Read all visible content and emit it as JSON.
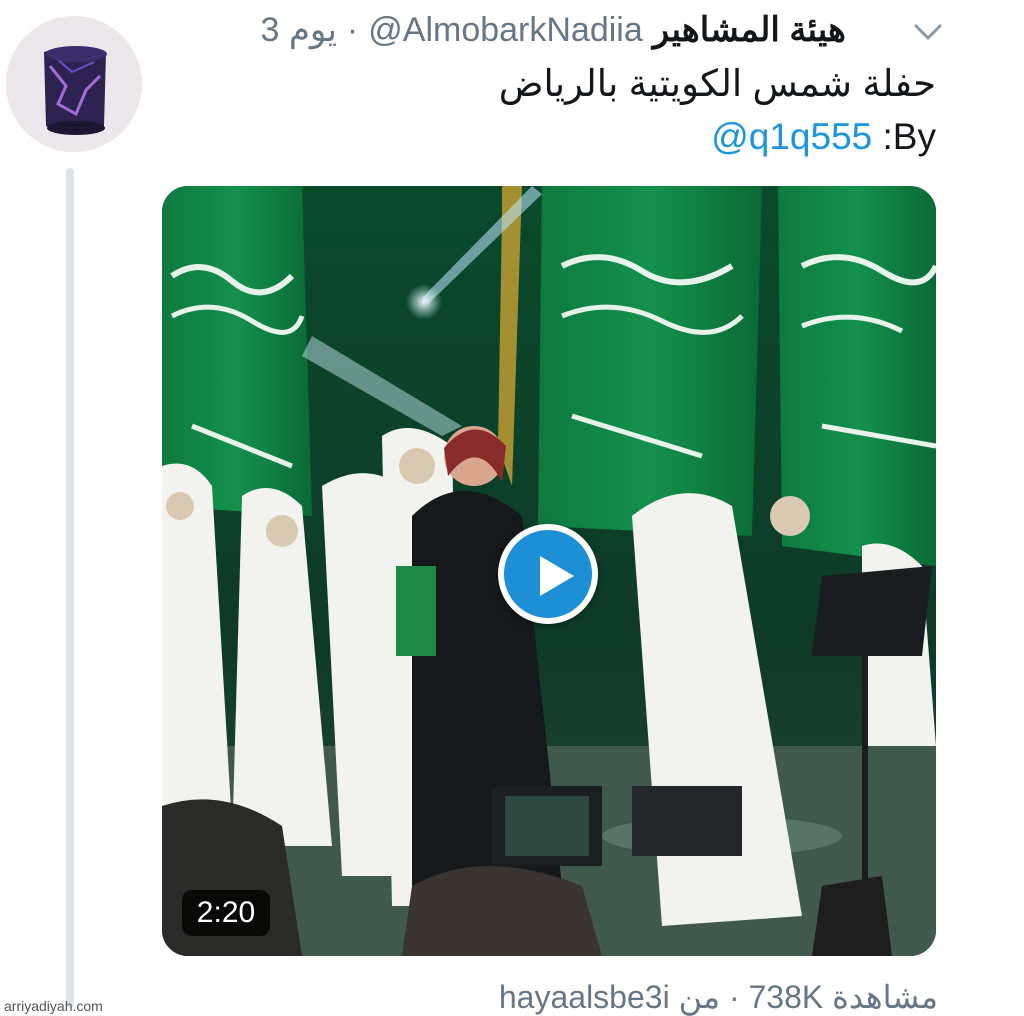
{
  "tweet": {
    "display_name": "هيئة المشاهير",
    "handle": "@AlmobarkNadiia",
    "time": "3 يوم",
    "separator": "·",
    "text": "حفلة شمس الكويتية بالرياض",
    "by_label": ":By",
    "by_mention": "@q1q555",
    "video": {
      "duration": "2:20"
    },
    "views_text": "مشاهدة 738K · من hayaalsbe3i"
  },
  "watermark": "arriyadiyah.com",
  "colors": {
    "link": "#1b95e0",
    "play_button": "#1d8fd6",
    "secondary_text": "#657786",
    "flag_green": "#0c7a3e",
    "thread_line": "#dfe4e9"
  },
  "icons": {
    "menu": "chevron-down-icon",
    "play": "play-icon"
  }
}
